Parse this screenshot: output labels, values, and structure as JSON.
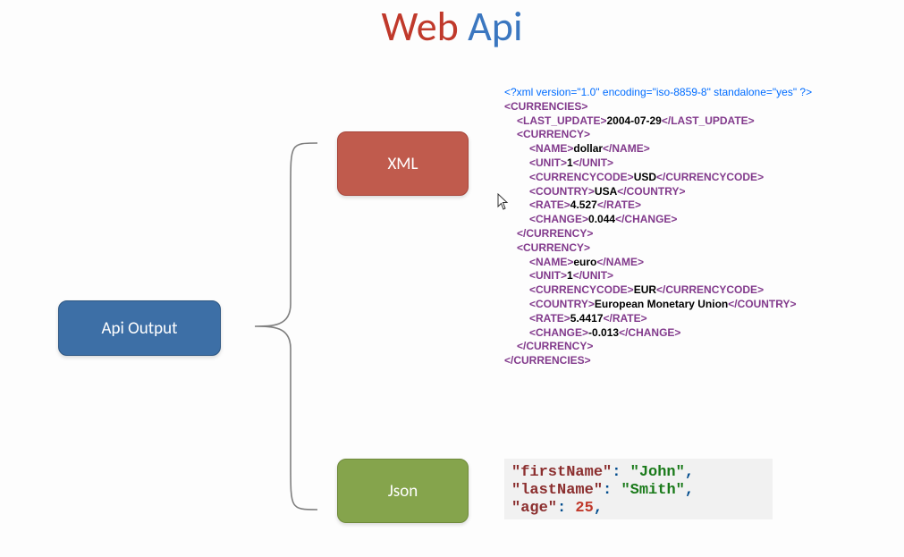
{
  "title": {
    "web": "Web",
    "api": "Api"
  },
  "boxes": {
    "api_output": "Api Output",
    "xml": "XML",
    "json": "Json"
  },
  "xml": {
    "pi": "<?xml version=\"1.0\" encoding=\"iso-8859-8\" standalone=\"yes\" ?>",
    "root_open": "<CURRENCIES>",
    "last_update_open": "<LAST_UPDATE>",
    "last_update_val": "2004-07-29",
    "last_update_close": "</LAST_UPDATE>",
    "currency_open": "<CURRENCY>",
    "currency_close": "</CURRENCY>",
    "root_close": "</CURRENCIES>",
    "name_open": "<NAME>",
    "name_close": "</NAME>",
    "unit_open": "<UNIT>",
    "unit_close": "</UNIT>",
    "cc_open": "<CURRENCYCODE>",
    "cc_close": "</CURRENCYCODE>",
    "country_open": "<COUNTRY>",
    "country_close": "</COUNTRY>",
    "rate_open": "<RATE>",
    "rate_close": "</RATE>",
    "change_open": "<CHANGE>",
    "change_close": "</CHANGE>",
    "c1": {
      "name": "dollar",
      "unit": "1",
      "code": "USD",
      "country": "USA",
      "rate": "4.527",
      "change": "0.044"
    },
    "c2": {
      "name": "euro",
      "unit": "1",
      "code": "EUR",
      "country": "European Monetary Union",
      "rate": "5.4417",
      "change": "-0.013"
    }
  },
  "json_snippet": {
    "k1": "\"firstName\"",
    "v1": "\"John\"",
    "k2": "\"lastName\"",
    "v2": "\"Smith\"",
    "k3": "\"age\"",
    "v3": "25",
    "colon": ":",
    "comma": ","
  }
}
